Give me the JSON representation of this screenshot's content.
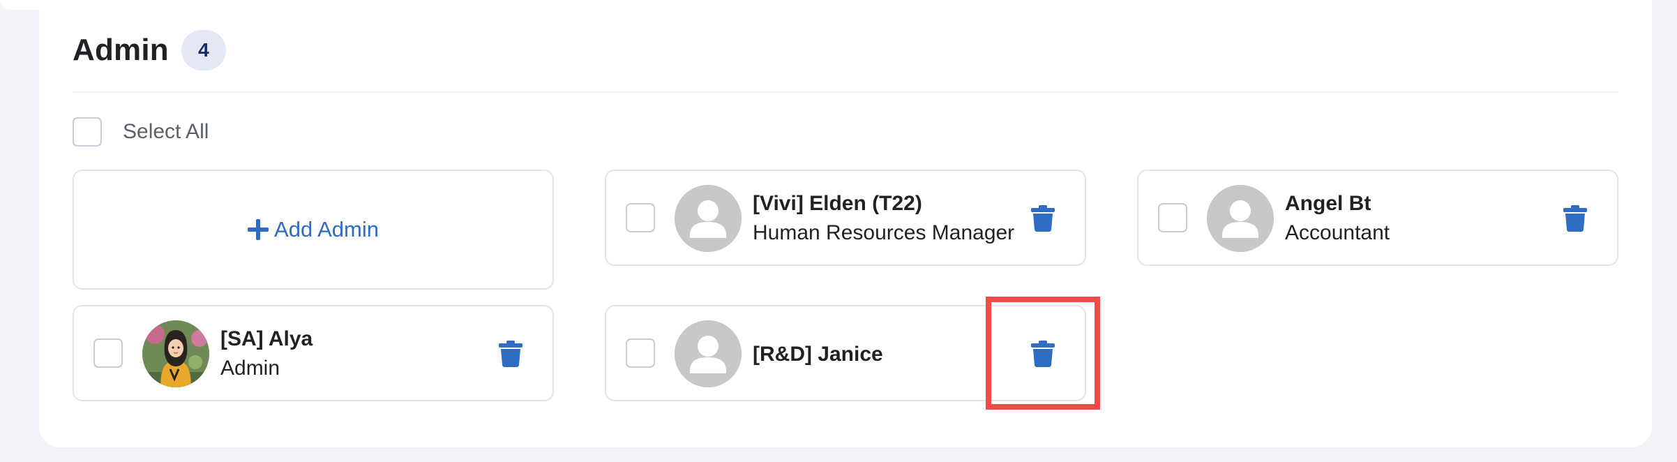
{
  "section": {
    "title": "Admin",
    "count": "4",
    "select_all_label": "Select All",
    "add_button_label": "Add Admin"
  },
  "admins": [
    {
      "name": "[Vivi] Elden (T22)",
      "role": "Human Resources Manager",
      "avatar": "default-person-icon"
    },
    {
      "name": "Angel Bt",
      "role": "Accountant",
      "avatar": "default-person-icon"
    },
    {
      "name": "[SA] Alya",
      "role": "Admin",
      "avatar": "photo"
    },
    {
      "name": "[R&D] Janice",
      "role": "",
      "avatar": "default-person-icon"
    }
  ],
  "icons": {
    "delete": "trash-icon",
    "add": "plus-icon",
    "avatar_placeholder": "person-icon"
  },
  "colors": {
    "accent": "#2f6dc4",
    "badge_bg": "#e4e8f5",
    "badge_text": "#1a2a6c",
    "highlight": "#f24b4b",
    "page_bg": "#f2f4fa"
  }
}
